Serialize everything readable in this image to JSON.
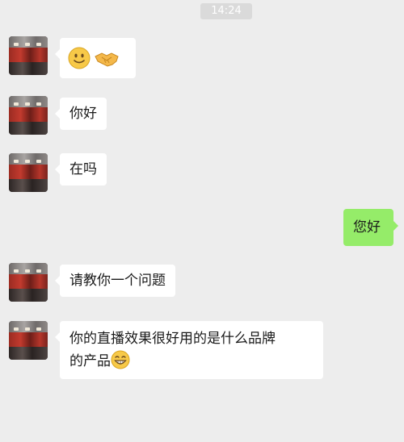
{
  "header": {
    "time": "14:24"
  },
  "messages": [
    {
      "side": "left",
      "text": "",
      "emoji": [
        "smile-icon",
        "handshake-icon"
      ]
    },
    {
      "side": "left",
      "text": "你好"
    },
    {
      "side": "left",
      "text": "在吗"
    },
    {
      "side": "right",
      "text": "您好"
    },
    {
      "side": "left",
      "text": "请教你一个问题"
    },
    {
      "side": "left",
      "line1": "你的直播效果很好用的是什么品牌",
      "line2": "的产品",
      "emoji": [
        "grin-icon"
      ]
    }
  ],
  "colors": {
    "background": "#ededed",
    "incoming_bubble": "#ffffff",
    "outgoing_bubble": "#95ec69",
    "time_badge": "#dadada"
  }
}
